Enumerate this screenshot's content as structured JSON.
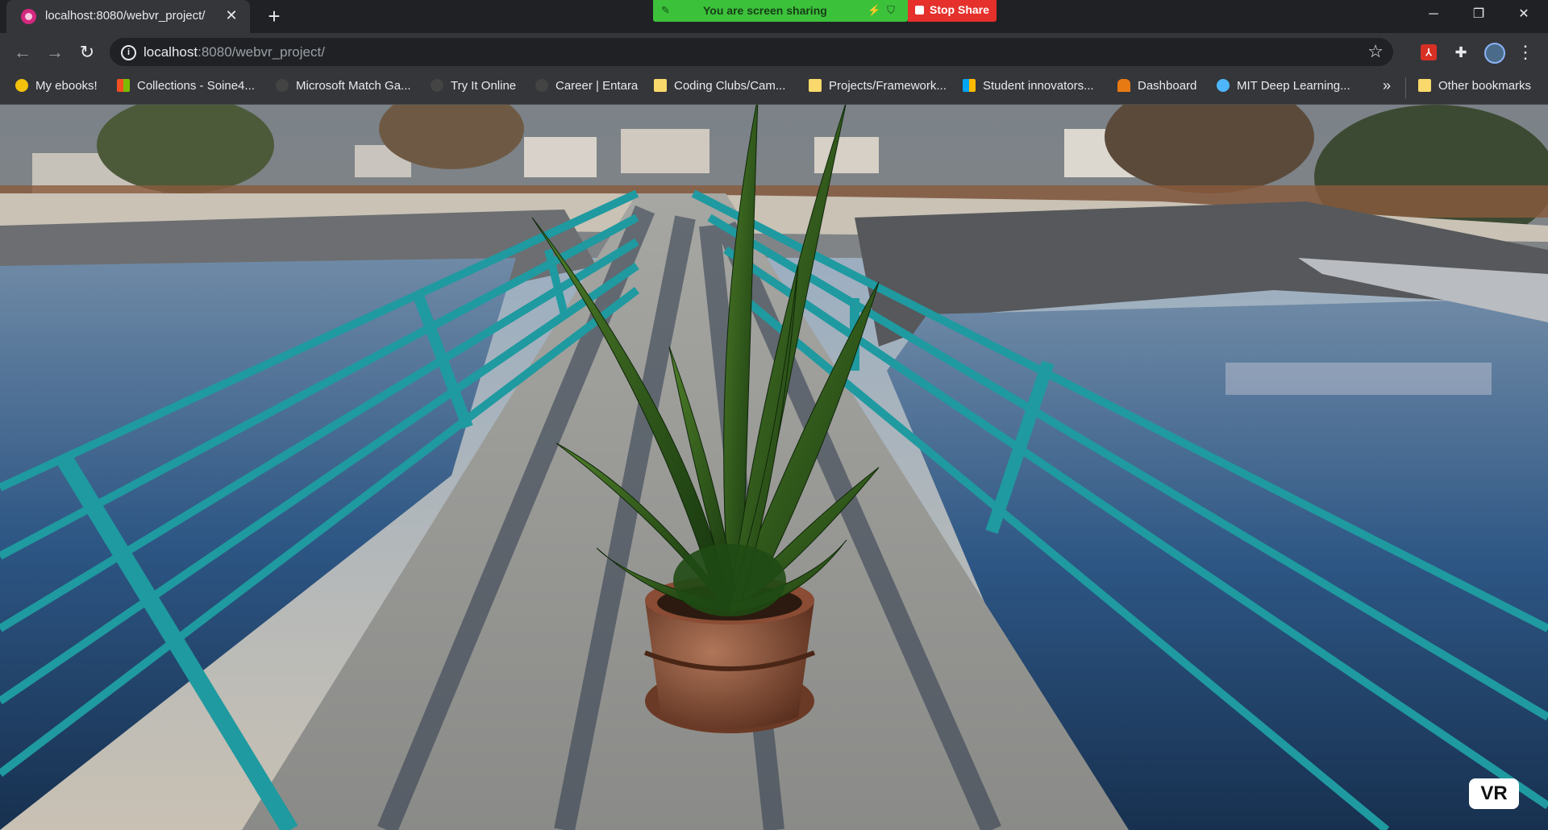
{
  "tab": {
    "title": "localhost:8080/webvr_project/",
    "close": "✕",
    "new_tab": "+"
  },
  "screen_share": {
    "message": "You are screen sharing",
    "stop_label": "Stop Share",
    "status_color": "#3cc13b",
    "stop_color": "#e5302b"
  },
  "window_controls": {
    "minimize": "─",
    "restore": "❐",
    "close": "✕"
  },
  "toolbar": {
    "back": "←",
    "forward": "→",
    "reload": "↻",
    "url_host": "localhost",
    "url_path": ":8080/webvr_project/",
    "star": "☆",
    "pdf": "⅄",
    "extensions": "✚",
    "menu": "⋮"
  },
  "bookmarks": [
    {
      "label": "My ebooks!",
      "icon": "emoji-icon"
    },
    {
      "label": "Collections - Soine4...",
      "icon": "microsoft-icon"
    },
    {
      "label": "Microsoft Match Ga...",
      "icon": "game-icon"
    },
    {
      "label": "Try It Online",
      "icon": "tio-icon"
    },
    {
      "label": "Career | Entara",
      "icon": "entara-icon"
    },
    {
      "label": "Coding Clubs/Cam...",
      "icon": "folder-icon"
    },
    {
      "label": "Projects/Framework...",
      "icon": "folder-icon"
    },
    {
      "label": "Student innovators...",
      "icon": "microsoft-icon"
    },
    {
      "label": "Dashboard",
      "icon": "dashboard-icon"
    },
    {
      "label": "MIT Deep Learning...",
      "icon": "mit-icon"
    }
  ],
  "bookmarks_more": "»",
  "other_bookmarks": "Other bookmarks",
  "vr_button": "VR"
}
